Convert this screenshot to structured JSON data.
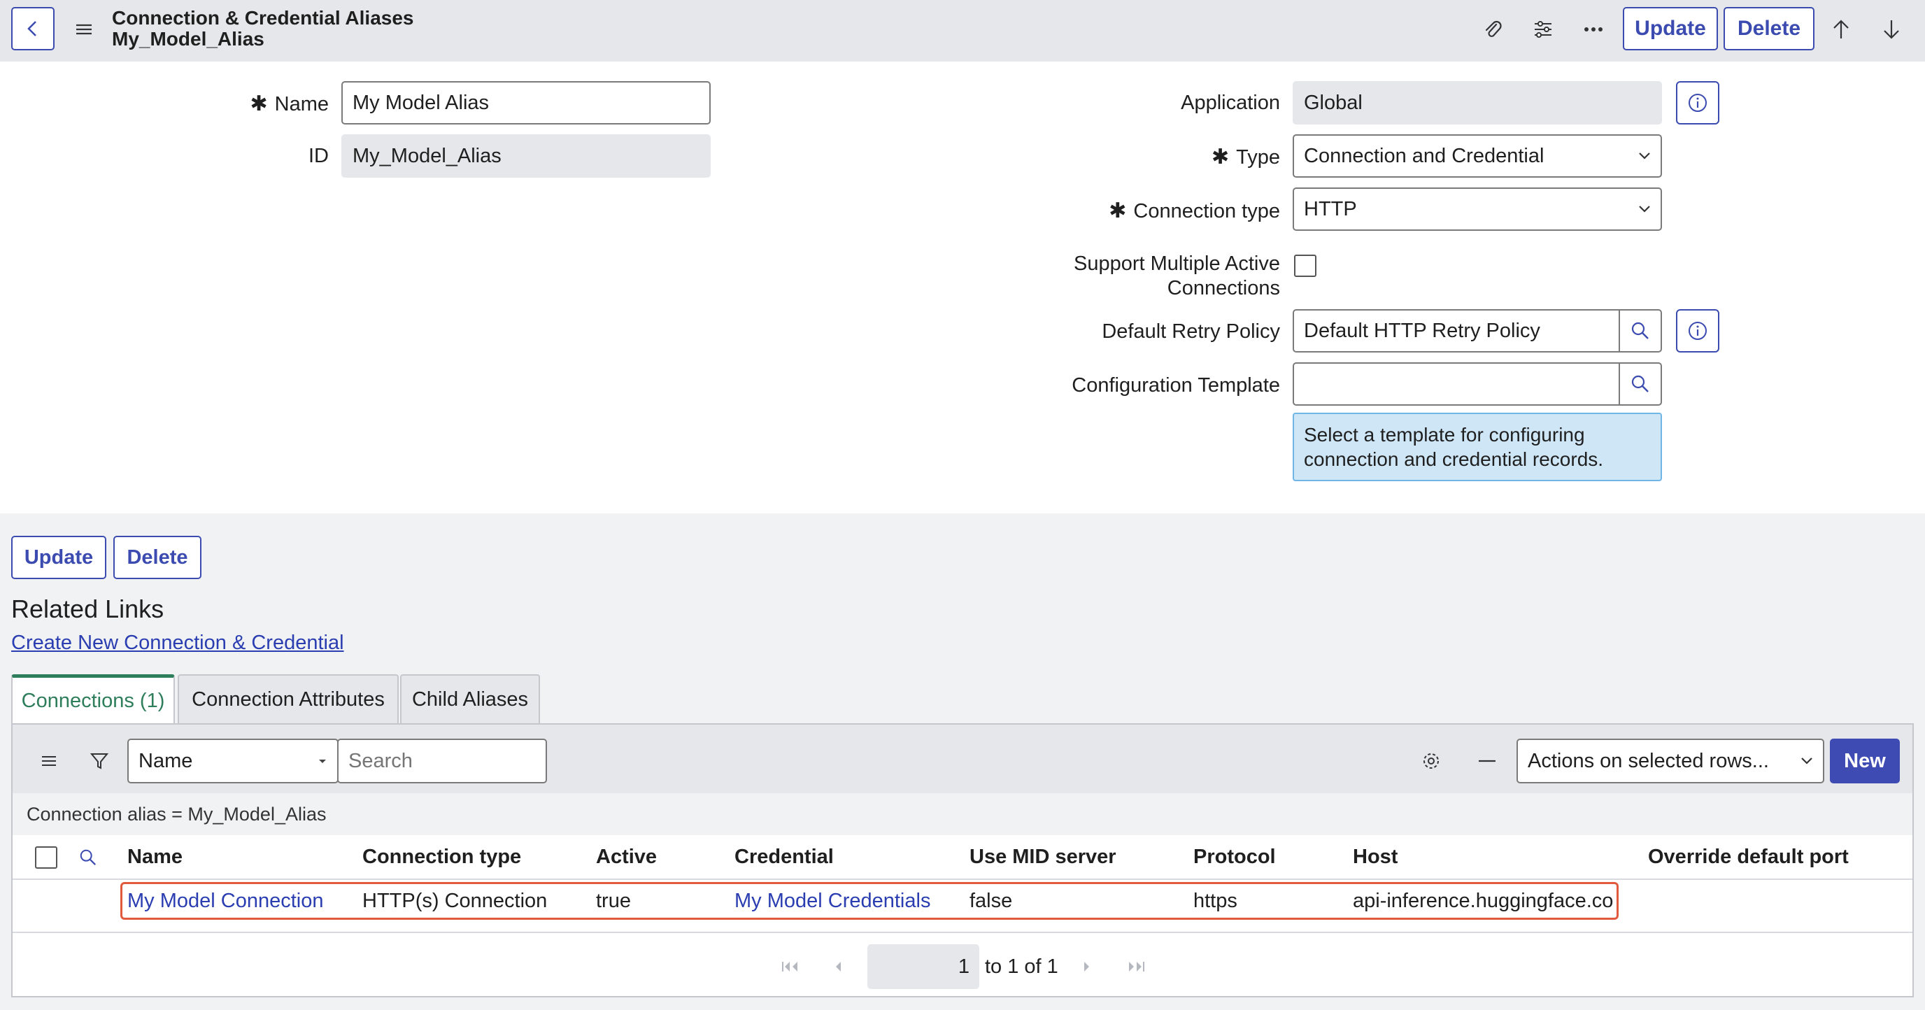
{
  "header": {
    "title": "Connection & Credential Aliases",
    "subtitle": "My_Model_Alias",
    "update_label": "Update",
    "delete_label": "Delete"
  },
  "form": {
    "name_label": "Name",
    "name_value": "My Model Alias",
    "id_label": "ID",
    "id_value": "My_Model_Alias",
    "application_label": "Application",
    "application_value": "Global",
    "type_label": "Type",
    "type_value": "Connection and Credential",
    "connection_type_label": "Connection type",
    "connection_type_value": "HTTP",
    "support_multiple_label_line1": "Support Multiple Active",
    "support_multiple_label_line2": "Connections",
    "support_multiple_checked": false,
    "retry_policy_label": "Default Retry Policy",
    "retry_policy_value": "Default HTTP Retry Policy",
    "config_template_label": "Configuration Template",
    "config_template_value": "",
    "config_template_hint_line1": "Select a template for configuring",
    "config_template_hint_line2": "connection and credential records."
  },
  "bottom_buttons": {
    "update_label": "Update",
    "delete_label": "Delete"
  },
  "related_links": {
    "heading": "Related Links",
    "create_link": "Create New Connection & Credential"
  },
  "tabs": [
    {
      "label": "Connections (1)",
      "active": true
    },
    {
      "label": "Connection Attributes",
      "active": false
    },
    {
      "label": "Child Aliases",
      "active": false
    }
  ],
  "list": {
    "search_field": "Name",
    "search_placeholder": "Search",
    "actions_label": "Actions on selected rows...",
    "new_label": "New",
    "condition": "Connection alias = My_Model_Alias",
    "columns": [
      "Name",
      "Connection type",
      "Active",
      "Credential",
      "Use MID server",
      "Protocol",
      "Host",
      "Override default port"
    ],
    "rows": [
      [
        "My Model Connection",
        "HTTP(s) Connection",
        "true",
        "My Model Credentials",
        "false",
        "https",
        "api-inference.huggingface.co",
        ""
      ]
    ],
    "pagination": {
      "page": "1",
      "range_text": "to 1 of 1"
    }
  },
  "colors": {
    "accent": "#3b4bb0",
    "highlight": "#e25a3e",
    "active_tab": "#2e7d5b",
    "hint_bg": "#cfe6f7"
  }
}
